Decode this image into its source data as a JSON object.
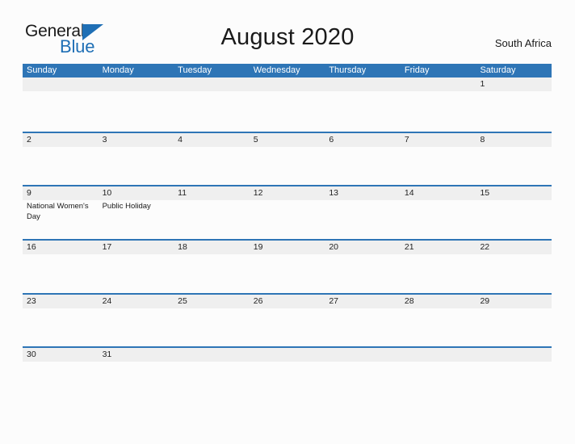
{
  "brand": {
    "name_part1": "General",
    "name_part2": "Blue"
  },
  "header": {
    "title": "August 2020",
    "region": "South Africa"
  },
  "calendar": {
    "weekdays": [
      "Sunday",
      "Monday",
      "Tuesday",
      "Wednesday",
      "Thursday",
      "Friday",
      "Saturday"
    ],
    "accent_color": "#2e75b6",
    "band_color": "#efefef",
    "weeks": [
      [
        {
          "day": "",
          "events": []
        },
        {
          "day": "",
          "events": []
        },
        {
          "day": "",
          "events": []
        },
        {
          "day": "",
          "events": []
        },
        {
          "day": "",
          "events": []
        },
        {
          "day": "",
          "events": []
        },
        {
          "day": "1",
          "events": []
        }
      ],
      [
        {
          "day": "2",
          "events": []
        },
        {
          "day": "3",
          "events": []
        },
        {
          "day": "4",
          "events": []
        },
        {
          "day": "5",
          "events": []
        },
        {
          "day": "6",
          "events": []
        },
        {
          "day": "7",
          "events": []
        },
        {
          "day": "8",
          "events": []
        }
      ],
      [
        {
          "day": "9",
          "events": [
            "National Women's Day"
          ]
        },
        {
          "day": "10",
          "events": [
            "Public Holiday"
          ]
        },
        {
          "day": "11",
          "events": []
        },
        {
          "day": "12",
          "events": []
        },
        {
          "day": "13",
          "events": []
        },
        {
          "day": "14",
          "events": []
        },
        {
          "day": "15",
          "events": []
        }
      ],
      [
        {
          "day": "16",
          "events": []
        },
        {
          "day": "17",
          "events": []
        },
        {
          "day": "18",
          "events": []
        },
        {
          "day": "19",
          "events": []
        },
        {
          "day": "20",
          "events": []
        },
        {
          "day": "21",
          "events": []
        },
        {
          "day": "22",
          "events": []
        }
      ],
      [
        {
          "day": "23",
          "events": []
        },
        {
          "day": "24",
          "events": []
        },
        {
          "day": "25",
          "events": []
        },
        {
          "day": "26",
          "events": []
        },
        {
          "day": "27",
          "events": []
        },
        {
          "day": "28",
          "events": []
        },
        {
          "day": "29",
          "events": []
        }
      ],
      [
        {
          "day": "30",
          "events": []
        },
        {
          "day": "31",
          "events": []
        },
        {
          "day": "",
          "events": []
        },
        {
          "day": "",
          "events": []
        },
        {
          "day": "",
          "events": []
        },
        {
          "day": "",
          "events": []
        },
        {
          "day": "",
          "events": []
        }
      ]
    ]
  }
}
